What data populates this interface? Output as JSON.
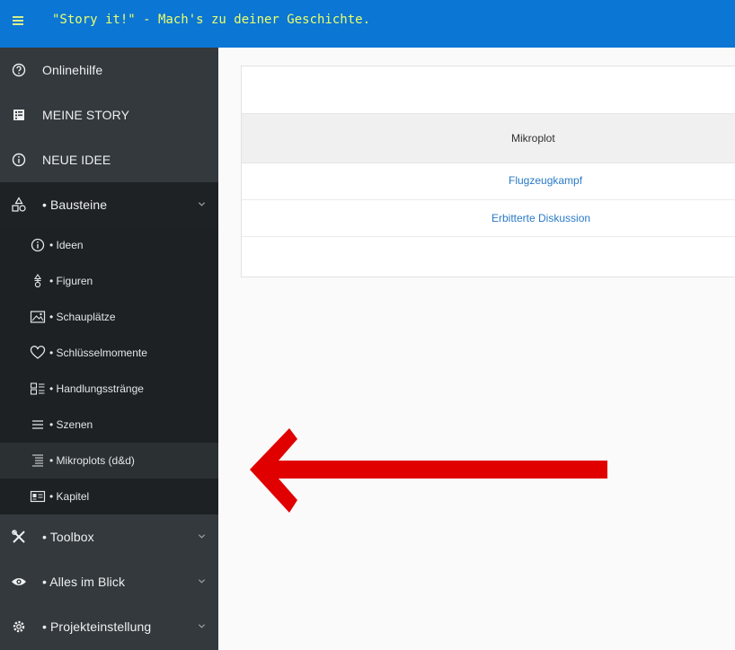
{
  "app": {
    "title": "\"Story it!\" - Mach's zu deiner Geschichte."
  },
  "colors": {
    "topbar": "#0b76d4",
    "title_text": "#ecff6b",
    "sidebar": "#34393d",
    "submenu": "#1d2123",
    "link": "#2a7ac7",
    "arrow": "#e00000"
  },
  "sidebar": {
    "items": [
      {
        "label": "Onlinehilfe",
        "icon": "help-circle-icon"
      },
      {
        "label": "MEINE STORY",
        "icon": "book-icon"
      },
      {
        "label": "NEUE IDEE",
        "icon": "info-circle-icon"
      }
    ],
    "groups": [
      {
        "label": "• Bausteine",
        "icon": "shapes-icon",
        "expanded": true
      },
      {
        "label": "• Toolbox",
        "icon": "tools-icon",
        "expanded": false
      },
      {
        "label": "• Alles im Blick",
        "icon": "eye-icon",
        "expanded": false
      },
      {
        "label": "• Projekteinstellung",
        "icon": "gear-icon",
        "expanded": false
      }
    ],
    "bausteine": [
      {
        "label": "• Ideen",
        "icon": "info-circle-icon"
      },
      {
        "label": "• Figuren",
        "icon": "figure-icon"
      },
      {
        "label": "• Schauplätze",
        "icon": "image-icon"
      },
      {
        "label": "• Schlüsselmomente",
        "icon": "heart-icon"
      },
      {
        "label": "• Handlungsstränge",
        "icon": "layout-list-icon"
      },
      {
        "label": "• Szenen",
        "icon": "lines-icon"
      },
      {
        "label": "• Mikroplots (d&d)",
        "icon": "indent-lines-icon",
        "active": true
      },
      {
        "label": "• Kapitel",
        "icon": "id-card-icon"
      }
    ]
  },
  "table": {
    "column_header": "Mikroplot",
    "rows": [
      "Flugzeugkampf",
      "Erbitterte Diskussion"
    ]
  }
}
